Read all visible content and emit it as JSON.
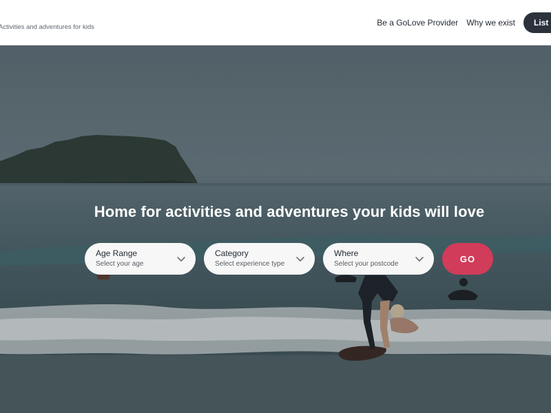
{
  "header": {
    "tagline": "Activities and adventures for kids",
    "nav": {
      "provider_link": "Be a GoLove Provider",
      "why_link": "Why we exist",
      "list_button": "List"
    }
  },
  "hero": {
    "title": "Home for activities and adventures your kids will love",
    "search": {
      "age": {
        "label": "Age Range",
        "placeholder": "Select your age"
      },
      "category": {
        "label": "Category",
        "placeholder": "Select experience type"
      },
      "where": {
        "label": "Where",
        "placeholder": "Select your postcode"
      },
      "go_label": "GO"
    }
  },
  "colors": {
    "accent": "#d13c5a",
    "nav_button": "#2b323b",
    "field_bg": "#f7f7f7"
  },
  "icons": {
    "dropdown": "chevron-down-icon"
  }
}
